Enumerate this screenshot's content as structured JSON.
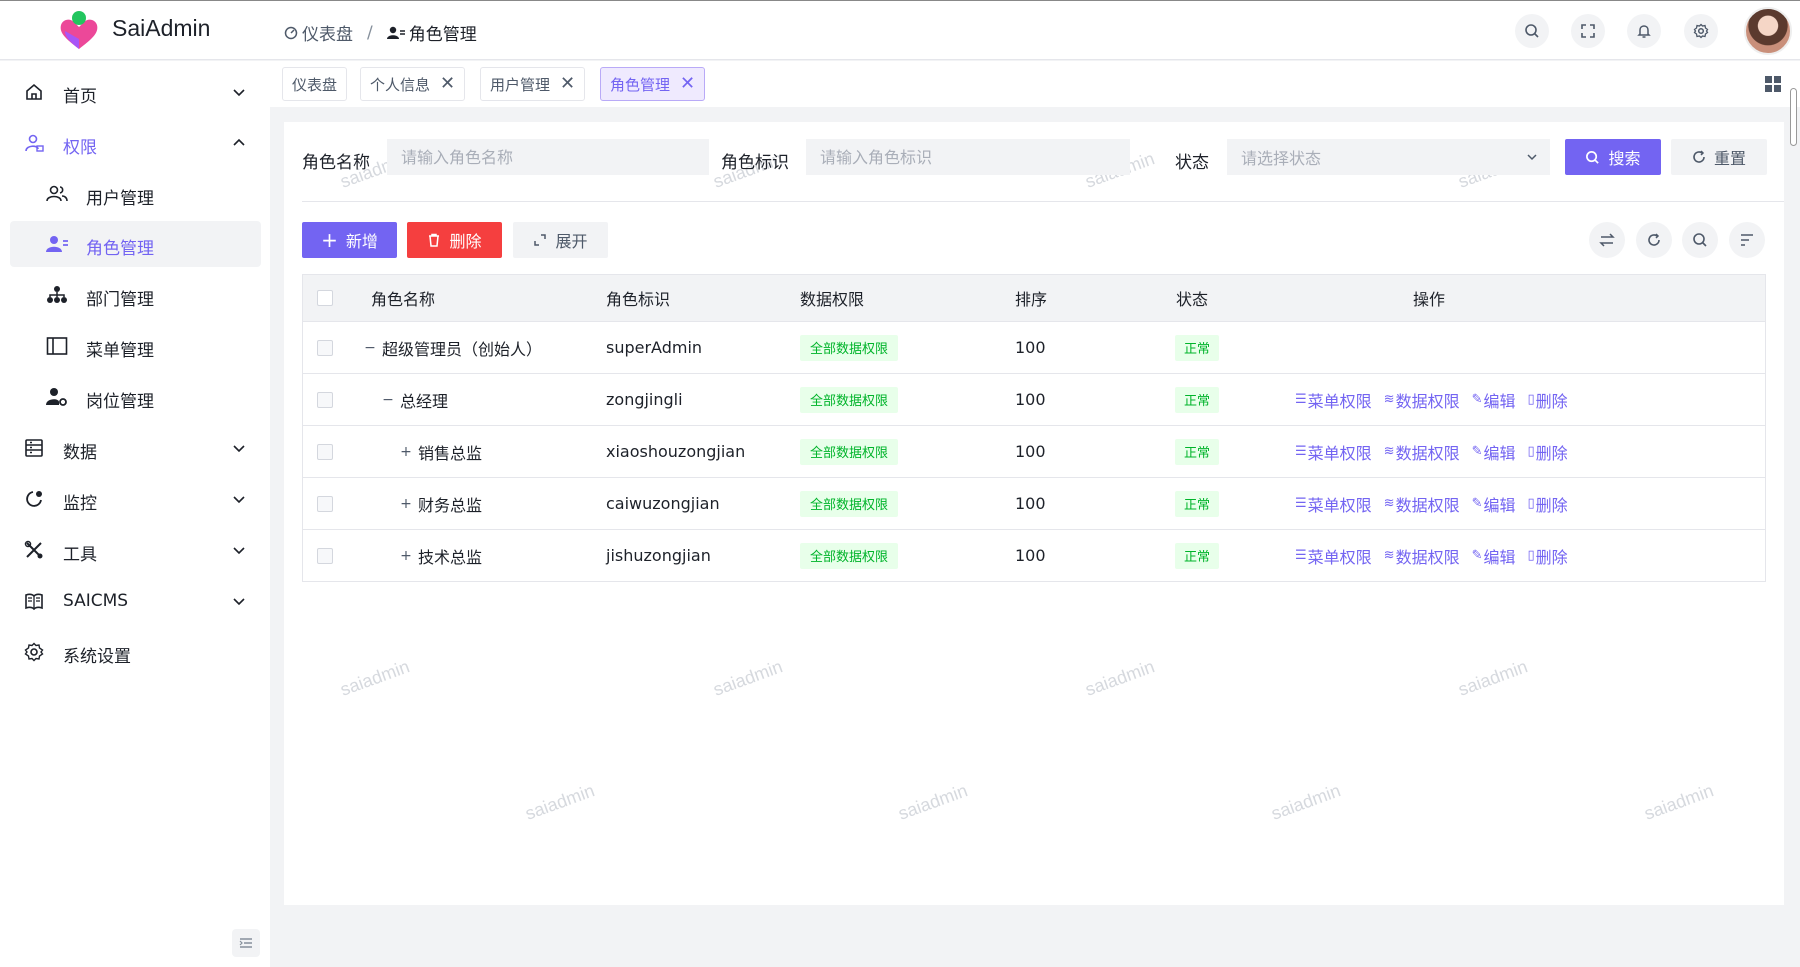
{
  "app": {
    "brand": "SaiAdmin"
  },
  "breadcrumb": [
    {
      "label": "仪表盘",
      "icon": "dashboard-icon"
    },
    {
      "label": "角色管理",
      "icon": "user-role-icon"
    }
  ],
  "header_actions": [
    "search-icon",
    "fullscreen-icon",
    "bell-icon",
    "gear-icon"
  ],
  "sidebar": {
    "items": [
      {
        "label": "首页",
        "icon": "home-icon",
        "expandable": true
      },
      {
        "label": "权限",
        "icon": "permission-icon",
        "expandable": true,
        "open": true
      },
      {
        "label": "用户管理",
        "icon": "users-icon"
      },
      {
        "label": "角色管理",
        "icon": "user-role-icon",
        "active": true
      },
      {
        "label": "部门管理",
        "icon": "org-icon"
      },
      {
        "label": "菜单管理",
        "icon": "layout-icon"
      },
      {
        "label": "岗位管理",
        "icon": "user-gear-icon"
      },
      {
        "label": "数据",
        "icon": "database-icon",
        "expandable": true
      },
      {
        "label": "监控",
        "icon": "monitor-icon",
        "expandable": true
      },
      {
        "label": "工具",
        "icon": "tools-icon",
        "expandable": true
      },
      {
        "label": "SAICMS",
        "icon": "book-icon",
        "expandable": true
      },
      {
        "label": "系统设置",
        "icon": "settings-icon"
      }
    ]
  },
  "tabs": [
    {
      "label": "仪表盘",
      "closable": false
    },
    {
      "label": "个人信息",
      "closable": true
    },
    {
      "label": "用户管理",
      "closable": true
    },
    {
      "label": "角色管理",
      "closable": true,
      "active": true
    }
  ],
  "search": {
    "role_name_label": "角色名称",
    "role_name_placeholder": "请输入角色名称",
    "role_code_label": "角色标识",
    "role_code_placeholder": "请输入角色标识",
    "status_label": "状态",
    "status_placeholder": "请选择状态",
    "search_button": "搜索",
    "reset_button": "重置"
  },
  "toolbar": {
    "add": "新增",
    "delete": "删除",
    "expand": "展开"
  },
  "table": {
    "columns": [
      "角色名称",
      "角色标识",
      "数据权限",
      "排序",
      "状态",
      "操作"
    ],
    "rows": [
      {
        "name": "超级管理员（创始人）",
        "code": "superAdmin",
        "data_scope": "全部数据权限",
        "sort": "100",
        "status": "正常",
        "level": 0,
        "toggle": "−",
        "actions": []
      },
      {
        "name": "总经理",
        "code": "zongjingli",
        "data_scope": "全部数据权限",
        "sort": "100",
        "status": "正常",
        "level": 1,
        "toggle": "−",
        "actions": [
          "菜单权限",
          "数据权限",
          "编辑",
          "删除"
        ]
      },
      {
        "name": "销售总监",
        "code": "xiaoshouzongjian",
        "data_scope": "全部数据权限",
        "sort": "100",
        "status": "正常",
        "level": 2,
        "toggle": "+",
        "actions": [
          "菜单权限",
          "数据权限",
          "编辑",
          "删除"
        ]
      },
      {
        "name": "财务总监",
        "code": "caiwuzongjian",
        "data_scope": "全部数据权限",
        "sort": "100",
        "status": "正常",
        "level": 2,
        "toggle": "+",
        "actions": [
          "菜单权限",
          "数据权限",
          "编辑",
          "删除"
        ]
      },
      {
        "name": "技术总监",
        "code": "jishuzongjian",
        "data_scope": "全部数据权限",
        "sort": "100",
        "status": "正常",
        "level": 2,
        "toggle": "+",
        "actions": [
          "菜单权限",
          "数据权限",
          "编辑",
          "删除"
        ]
      }
    ]
  },
  "watermark": "saiadmin",
  "colors": {
    "primary": "#7364f2",
    "danger": "#f53f3f",
    "success": "#00b42a"
  }
}
